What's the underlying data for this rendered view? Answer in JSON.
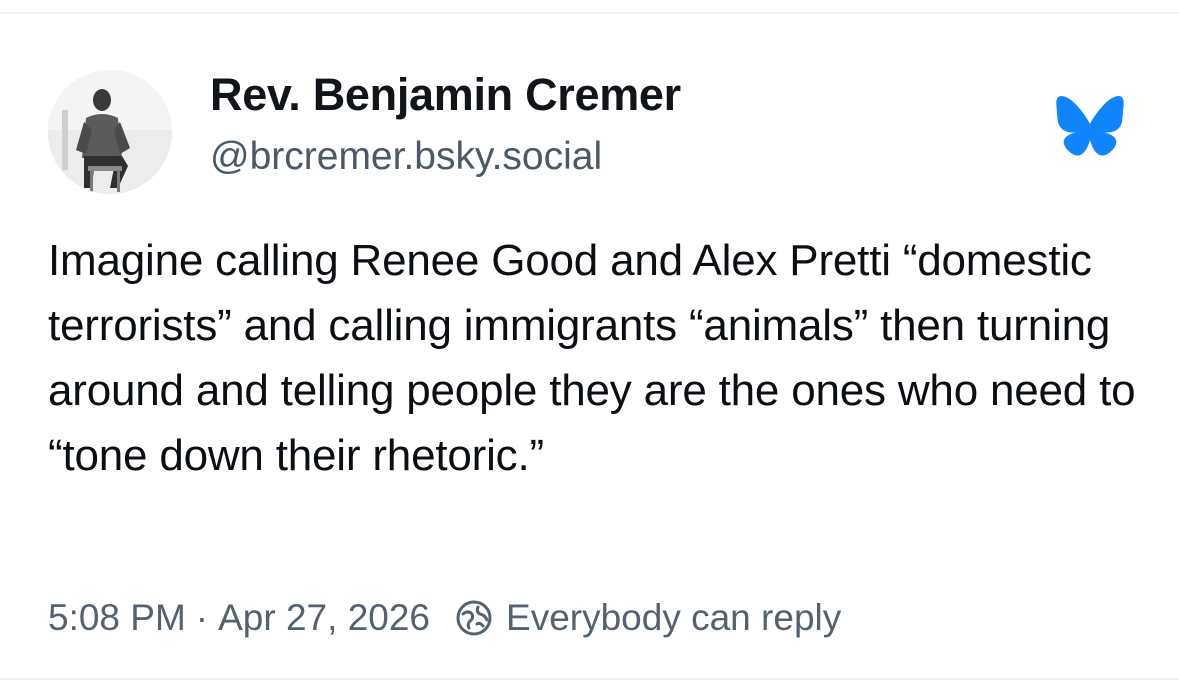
{
  "post": {
    "author": {
      "display_name": "Rev. Benjamin Cremer",
      "handle": "@brcremer.bsky.social",
      "avatar_icon": "user-avatar-photo"
    },
    "platform_icon": "bluesky-butterfly-icon",
    "text": "Imagine calling Renee Good and Alex Pretti “domestic terrorists” and calling immigrants “animals” then turning around and telling people they are the ones who need to “tone down their rhetoric.”",
    "time": "5:08 PM",
    "separator": "·",
    "date": "Apr 27, 2026",
    "reply_setting_icon": "reply-permission-icon",
    "reply_setting": "Everybody can reply"
  },
  "colors": {
    "brand_blue": "#1185fe",
    "text_primary": "#0b0f14",
    "text_secondary": "#55616e"
  }
}
